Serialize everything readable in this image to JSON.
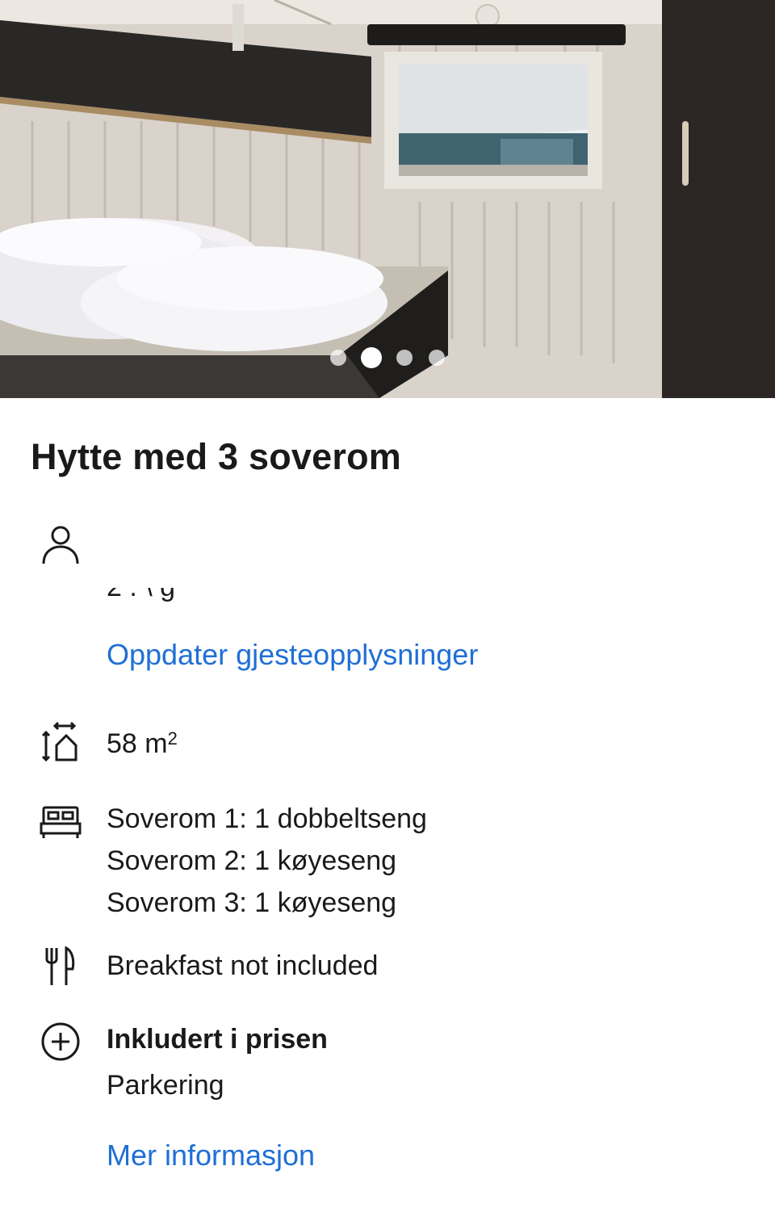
{
  "gallery": {
    "total_images": 4,
    "active_index": 1
  },
  "room": {
    "title": "Hytte med 3 soverom"
  },
  "guests": {
    "icon": "person-icon",
    "truncated_text": "2 .                    \\                g",
    "update_link": "Oppdater gjesteopplysninger"
  },
  "size": {
    "icon": "floor-area-icon",
    "value": "58 m",
    "unit_superscript": "2"
  },
  "beds": {
    "icon": "bed-icon",
    "lines": [
      "Soverom 1: 1 dobbeltseng",
      "Soverom 2: 1 køyeseng",
      "Soverom 3: 1 køyeseng"
    ]
  },
  "meals": {
    "icon": "cutlery-icon",
    "text": "Breakfast not included"
  },
  "included": {
    "icon": "plus-circle-icon",
    "heading": "Inkludert i prisen",
    "item": "Parkering"
  },
  "more_link": "Mer informasjon",
  "colors": {
    "link": "#1f6fd6",
    "text": "#1a1a1a"
  }
}
